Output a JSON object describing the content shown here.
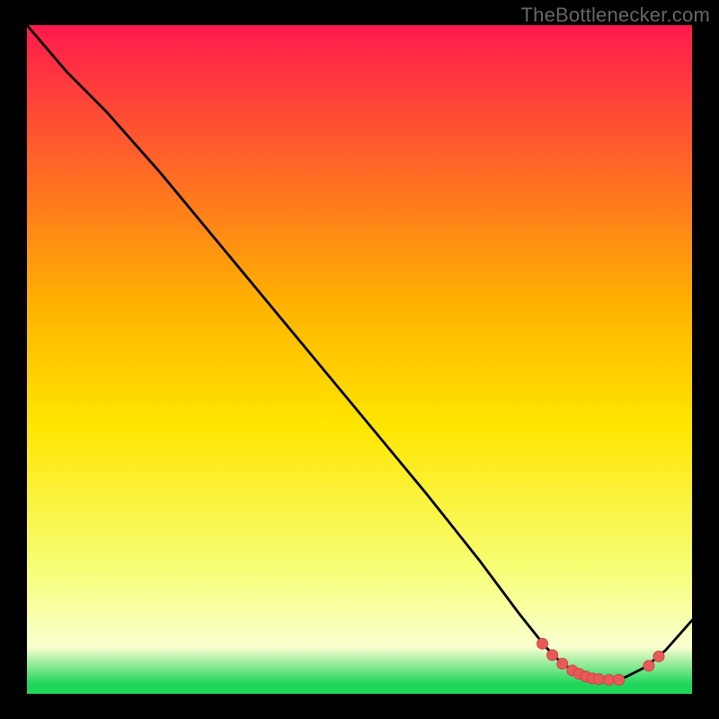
{
  "watermark": "TheBottlenecker.com",
  "colors": {
    "frame": "#000000",
    "watermark_text": "#666666",
    "curve": "#000000",
    "dot_fill": "#e85a5a",
    "dot_stroke": "#c44",
    "grad_top": "#ff1a4d",
    "grad_upper_mid": "#ffb300",
    "grad_mid": "#ffe600",
    "grad_lower_mid": "#f6ff7a",
    "grad_pale": "#faffd0",
    "grad_green": "#1fd65a"
  },
  "chart_data": {
    "type": "line",
    "title": "",
    "xlabel": "",
    "ylabel": "",
    "xlim": [
      0,
      100
    ],
    "ylim": [
      0,
      100
    ],
    "series": [
      {
        "name": "bottleneck-curve",
        "x": [
          0,
          6,
          12,
          20,
          30,
          40,
          50,
          60,
          68,
          74,
          78,
          80,
          82,
          84,
          86,
          88,
          90,
          93,
          96,
          100
        ],
        "y": [
          100,
          93,
          87,
          78,
          66,
          54,
          42,
          30,
          20,
          12,
          7,
          5,
          3.5,
          2.5,
          2,
          2,
          2.5,
          4,
          6.5,
          11
        ]
      }
    ],
    "marker_cluster": {
      "name": "highlighted-points",
      "x": [
        77.5,
        79,
        80.5,
        82,
        83,
        84,
        85,
        86,
        87.5,
        89,
        93.5,
        95
      ],
      "y": [
        7.5,
        5.8,
        4.5,
        3.5,
        3.0,
        2.6,
        2.3,
        2.2,
        2.1,
        2.1,
        4.2,
        5.6
      ]
    },
    "background_gradient_stops": [
      {
        "offset": 0,
        "hue": "red-magenta"
      },
      {
        "offset": 0.45,
        "hue": "orange"
      },
      {
        "offset": 0.62,
        "hue": "yellow"
      },
      {
        "offset": 0.82,
        "hue": "pale-yellow"
      },
      {
        "offset": 0.93,
        "hue": "cream"
      },
      {
        "offset": 0.985,
        "hue": "green"
      }
    ]
  }
}
